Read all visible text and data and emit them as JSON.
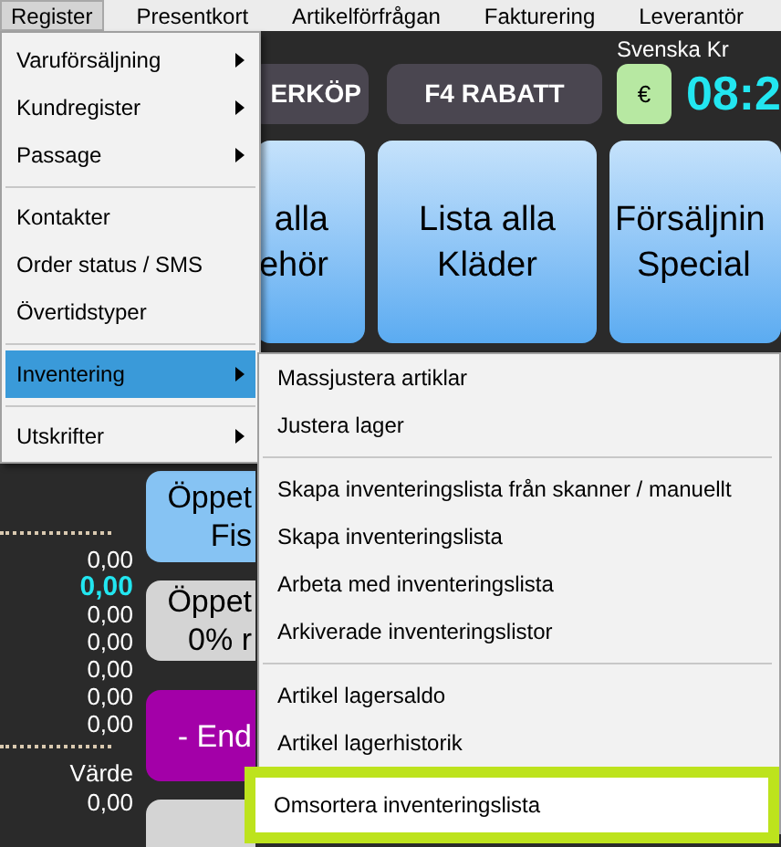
{
  "menu_bar": [
    {
      "label": "Register",
      "selected": true
    },
    {
      "label": "Presentkort",
      "selected": false
    },
    {
      "label": "Artikelförfrågan",
      "selected": false
    },
    {
      "label": "Fakturering",
      "selected": false
    },
    {
      "label": "Leverantör",
      "selected": false
    }
  ],
  "toolbar": {
    "buttons": [
      "ERKÖP",
      "F4 RABATT"
    ],
    "currency_label": "Svenska Kr",
    "currency_button": "€",
    "clock": "08:2"
  },
  "tiles": [
    {
      "lines": [
        "alla",
        "ehör"
      ]
    },
    {
      "lines": [
        "Lista alla",
        "Kläder"
      ]
    },
    {
      "lines": [
        "Försäljnin",
        "Special"
      ]
    }
  ],
  "totals": {
    "values": [
      {
        "value": "0,00",
        "highlighted": false
      },
      {
        "value": "0,00",
        "highlighted": true
      },
      {
        "value": "0,00",
        "highlighted": false
      },
      {
        "value": "0,00",
        "highlighted": false
      },
      {
        "value": "0,00",
        "highlighted": false
      },
      {
        "value": "0,00",
        "highlighted": false
      },
      {
        "value": "0,00",
        "highlighted": false
      }
    ],
    "value_label": "Värde",
    "value_total": "0,00"
  },
  "side_buttons": [
    {
      "lines": [
        "Öppet",
        "Fis"
      ],
      "color": "#86c3f3"
    },
    {
      "lines": [
        "Öppet",
        "0% r"
      ],
      "color": "#d4d4d4"
    },
    {
      "lines": [
        "- End"
      ],
      "color": "#a300a8"
    },
    {
      "color": "#d4d4d4"
    }
  ],
  "register_menu": [
    {
      "kind": "item",
      "label": "Varuförsäljning",
      "submenu": true,
      "selected": false
    },
    {
      "kind": "item",
      "label": "Kundregister",
      "submenu": true,
      "selected": false
    },
    {
      "kind": "item",
      "label": "Passage",
      "submenu": true,
      "selected": false
    },
    {
      "kind": "separator"
    },
    {
      "kind": "item",
      "label": "Kontakter",
      "submenu": false,
      "selected": false
    },
    {
      "kind": "item",
      "label": "Order status / SMS",
      "submenu": false,
      "selected": false
    },
    {
      "kind": "item",
      "label": "Övertidstyper",
      "submenu": false,
      "selected": false
    },
    {
      "kind": "separator"
    },
    {
      "kind": "item",
      "label": "Inventering",
      "submenu": true,
      "selected": true
    },
    {
      "kind": "separator"
    },
    {
      "kind": "item",
      "label": "Utskrifter",
      "submenu": true,
      "selected": false
    }
  ],
  "inventering_menu": [
    {
      "kind": "item",
      "label": "Massjustera artiklar",
      "highlighted": false
    },
    {
      "kind": "item",
      "label": "Justera lager",
      "highlighted": false
    },
    {
      "kind": "separator"
    },
    {
      "kind": "item",
      "label": "Skapa inventeringslista från skanner / manuellt",
      "highlighted": false
    },
    {
      "kind": "item",
      "label": "Skapa inventeringslista",
      "highlighted": false
    },
    {
      "kind": "item",
      "label": "Arbeta med inventeringslista",
      "highlighted": false
    },
    {
      "kind": "item",
      "label": "Arkiverade inventeringslistor",
      "highlighted": false
    },
    {
      "kind": "separator"
    },
    {
      "kind": "item",
      "label": "Artikel lagersaldo",
      "highlighted": false
    },
    {
      "kind": "item",
      "label": "Artikel lagerhistorik",
      "highlighted": false
    },
    {
      "kind": "item",
      "label": "Omsortera inventeringslista",
      "highlighted": true
    }
  ]
}
